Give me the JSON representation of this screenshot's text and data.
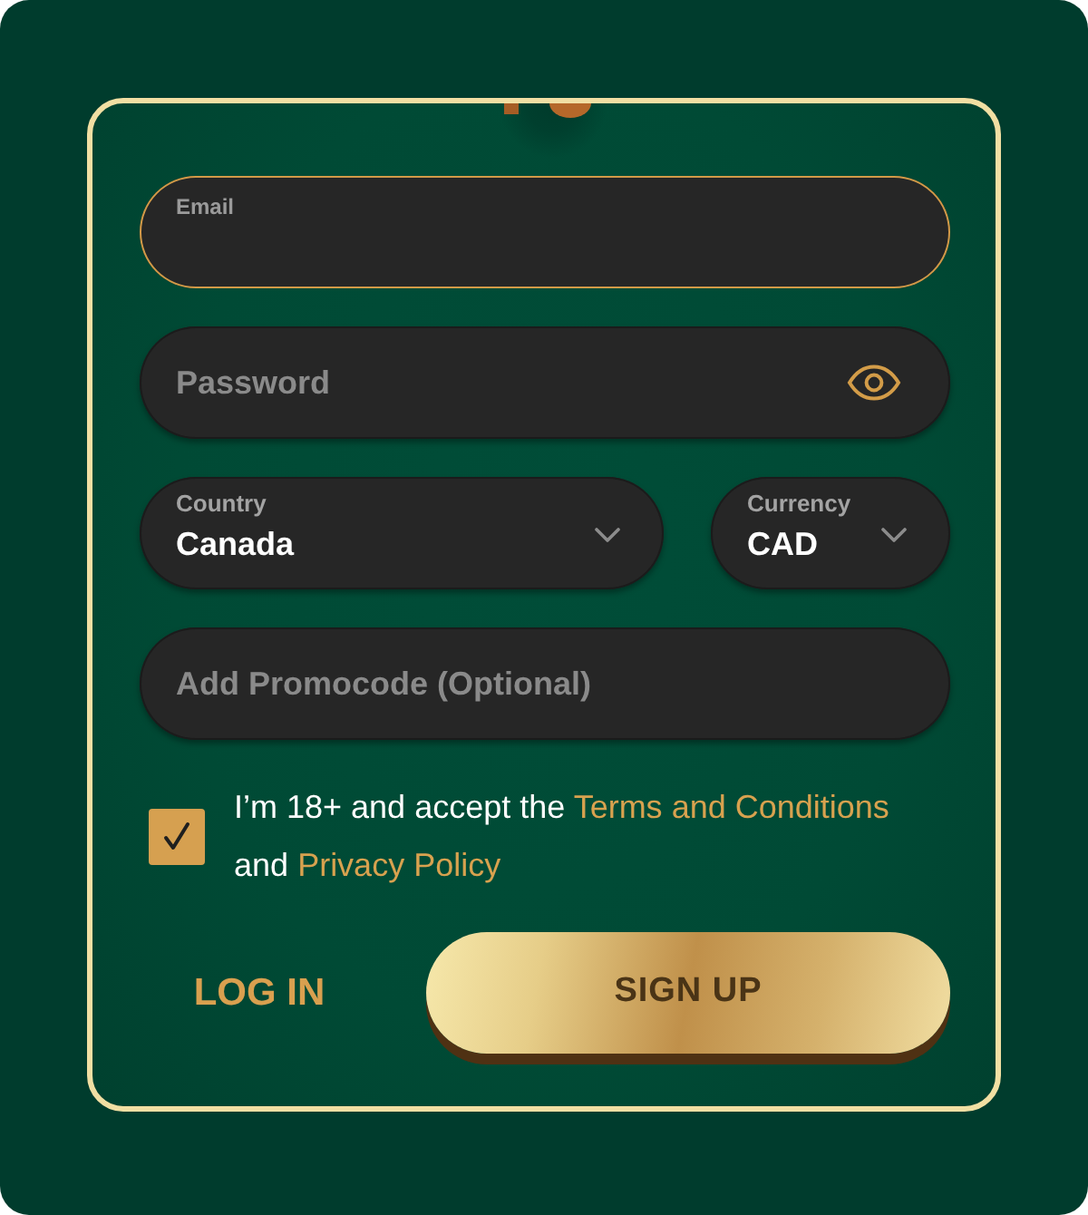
{
  "form": {
    "fields": [
      {
        "kind": "input",
        "label": "Email",
        "focused": true
      },
      {
        "kind": "password",
        "placeholder": "Password",
        "focused": false
      },
      {
        "kind": "select_pair",
        "selects": [
          {
            "label": "Country",
            "value": "Canada"
          },
          {
            "label": "Currency",
            "value": "CAD"
          }
        ]
      },
      {
        "kind": "input",
        "placeholder": "Add Promocode (Optional)",
        "focused": false
      }
    ],
    "consent": {
      "checked": true,
      "parts": [
        {
          "kind": "text",
          "text": "I’m 18+ and accept the"
        },
        {
          "kind": "link",
          "text": "Terms and Conditions"
        },
        {
          "kind": "text",
          "text": "and"
        },
        {
          "kind": "link",
          "text": "Privacy Policy"
        }
      ]
    },
    "actions": [
      {
        "kind": "link",
        "label": "LOG IN"
      },
      {
        "kind": "primary",
        "label": "SIGN UP"
      }
    ]
  }
}
